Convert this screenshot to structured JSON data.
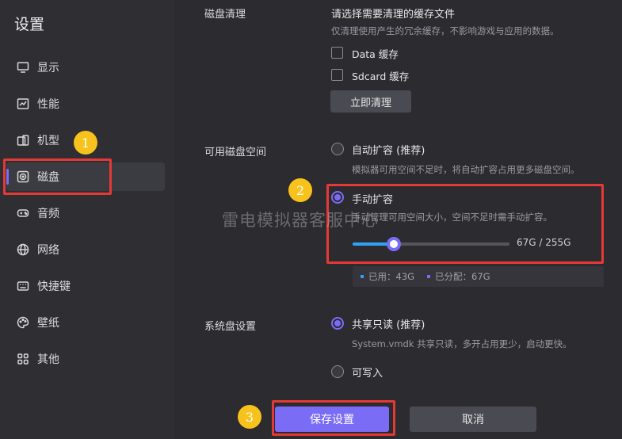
{
  "sidebar": {
    "title": "设置",
    "items": [
      {
        "label": "显示",
        "icon": "monitor-icon"
      },
      {
        "label": "性能",
        "icon": "performance-icon"
      },
      {
        "label": "机型",
        "icon": "device-model-icon"
      },
      {
        "label": "磁盘",
        "icon": "disk-icon",
        "active": true
      },
      {
        "label": "音频",
        "icon": "gamepad-audio-icon"
      },
      {
        "label": "网络",
        "icon": "globe-icon"
      },
      {
        "label": "快捷键",
        "icon": "keyboard-icon"
      },
      {
        "label": "壁纸",
        "icon": "palette-icon"
      },
      {
        "label": "其他",
        "icon": "grid-icon"
      }
    ]
  },
  "disk_clean": {
    "section_label": "磁盘清理",
    "heading": "请选择需要清理的缓存文件",
    "note": "仅清理使用产生的冗余缓存，不影响游戏与应用的数据。",
    "options": [
      {
        "label": "Data 缓存",
        "checked": false
      },
      {
        "label": "Sdcard 缓存",
        "checked": false
      }
    ],
    "button": "立即清理"
  },
  "disk_space": {
    "section_label": "可用磁盘空间",
    "auto_label": "自动扩容 (推荐)",
    "auto_note": "模拟器可用空间不足时，将自动扩容占用更多磁盘空间。",
    "manual_label": "手动扩容",
    "manual_note": "手动管理可用空间大小，空间不足时需手动扩容。",
    "slider_value_text": "67G / 255G",
    "slider_fraction": 0.263,
    "used_text": "已用：43G",
    "allocated_text": "已分配：67G",
    "used_color": "#2fa3f5",
    "allocated_color": "#7b6cf6"
  },
  "system_disk": {
    "section_label": "系统盘设置",
    "shared_label": "共享只读 (推荐)",
    "shared_note": "System.vmdk 共享只读，多开占用更少，启动更快。",
    "writable_label": "可写入"
  },
  "actions": {
    "save": "保存设置",
    "cancel": "取消"
  },
  "annotations": {
    "badge_1": "1",
    "badge_2": "2",
    "badge_3": "3"
  },
  "watermark": "雷电模拟器客服中心"
}
